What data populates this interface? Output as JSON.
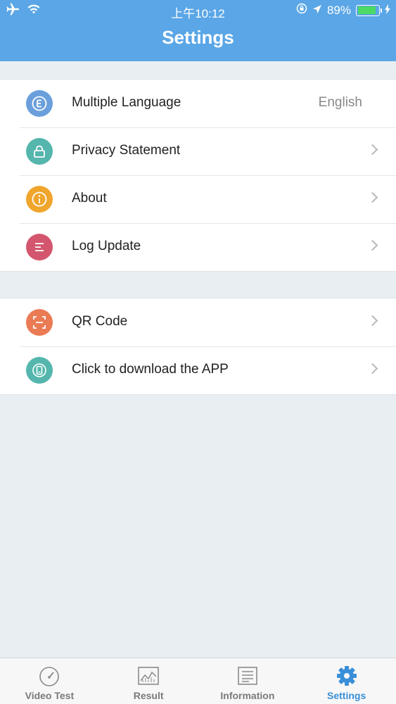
{
  "status_bar": {
    "time": "上午10:12",
    "battery": "89%",
    "battery_level": 0.89
  },
  "header": {
    "title": "Settings"
  },
  "colors": {
    "header": "#5aa6e6",
    "language_icon": "#6a9fdc",
    "privacy_icon": "#54b6ad",
    "about_icon": "#f0a52c",
    "log_icon": "#d4566e",
    "qr_icon": "#ea7b54",
    "download_icon": "#54b6ad",
    "active_tab": "#3a8fd8"
  },
  "settings_group1": [
    {
      "label": "Multiple Language",
      "value": "English",
      "icon": "language-icon"
    },
    {
      "label": "Privacy Statement",
      "icon": "lock-icon"
    },
    {
      "label": "About",
      "icon": "info-icon"
    },
    {
      "label": "Log Update",
      "icon": "list-icon"
    }
  ],
  "settings_group2": [
    {
      "label": "QR Code",
      "icon": "qr-scan-icon"
    },
    {
      "label": "Click to download the APP",
      "icon": "phone-icon"
    }
  ],
  "tabs": [
    {
      "label": "Video Test",
      "icon": "speedometer-icon"
    },
    {
      "label": "Result",
      "icon": "chart-icon"
    },
    {
      "label": "Information",
      "icon": "document-icon"
    },
    {
      "label": "Settings",
      "icon": "gear-icon",
      "active": true
    }
  ]
}
